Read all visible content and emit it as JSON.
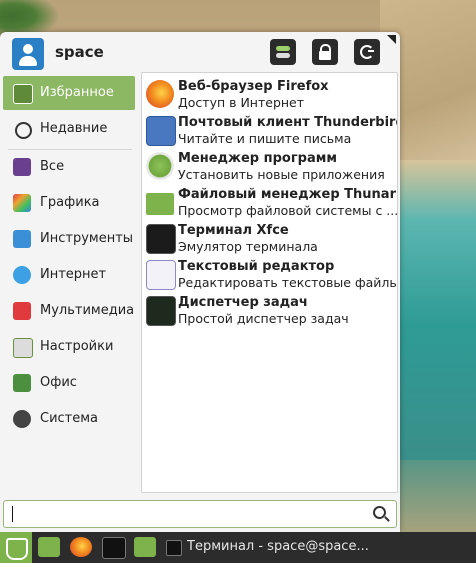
{
  "user": {
    "name": "space"
  },
  "header_buttons": [
    {
      "name": "settings",
      "icon": "settings-toggle-icon"
    },
    {
      "name": "lock",
      "icon": "lock-icon"
    },
    {
      "name": "logout",
      "icon": "logout-icon"
    }
  ],
  "categories": [
    {
      "label": "Избранное",
      "icon": "star-icon",
      "selected": true,
      "color": "#5e8a3a"
    },
    {
      "label": "Недавние",
      "icon": "clock-icon",
      "selected": false,
      "color": "#333333"
    },
    {
      "label": "Все",
      "icon": "all-apps-icon",
      "selected": false,
      "color": "#6a3f8f"
    },
    {
      "label": "Графика",
      "icon": "graphics-icon",
      "selected": false,
      "color": "#e0612a"
    },
    {
      "label": "Инструменты",
      "icon": "tools-icon",
      "selected": false,
      "color": "#3b8fd6"
    },
    {
      "label": "Интернет",
      "icon": "cloud-icon",
      "selected": false,
      "color": "#3ea0e4"
    },
    {
      "label": "Мультимедиа",
      "icon": "play-icon",
      "selected": false,
      "color": "#e0393e"
    },
    {
      "label": "Настройки",
      "icon": "settings-icon",
      "selected": false,
      "color": "#6b8f3f"
    },
    {
      "label": "Офис",
      "icon": "office-icon",
      "selected": false,
      "color": "#4b8f3f"
    },
    {
      "label": "Система",
      "icon": "gear-icon",
      "selected": false,
      "color": "#444444"
    }
  ],
  "apps": [
    {
      "name": "Веб-браузер Firefox",
      "desc": "Доступ в Интернет",
      "icon": "firefox-icon"
    },
    {
      "name": "Почтовый клиент Thunderbird",
      "desc": "Читайте и пишите письма",
      "icon": "mail-icon"
    },
    {
      "name": "Менеджер программ",
      "desc": "Установить новые приложения",
      "icon": "software-manager-icon"
    },
    {
      "name": "Файловый менеджер Thunar",
      "desc": "Просмотр файловой системы с ...",
      "icon": "folder-icon"
    },
    {
      "name": "Терминал Xfce",
      "desc": "Эмулятор терминала",
      "icon": "terminal-icon"
    },
    {
      "name": "Текстовый редактор",
      "desc": "Редактировать текстовые файлы",
      "icon": "text-editor-icon"
    },
    {
      "name": "Диспетчер задач",
      "desc": "Простой диспетчер задач",
      "icon": "task-manager-icon"
    }
  ],
  "search": {
    "value": "",
    "placeholder": ""
  },
  "panel": {
    "launchers": [
      {
        "name": "show-desktop",
        "icon": "desktop-icon"
      },
      {
        "name": "firefox",
        "icon": "firefox-icon"
      },
      {
        "name": "terminal",
        "icon": "terminal-icon"
      },
      {
        "name": "file-manager",
        "icon": "folder-icon"
      }
    ],
    "task": {
      "label": "Терминал - space@space..."
    }
  }
}
